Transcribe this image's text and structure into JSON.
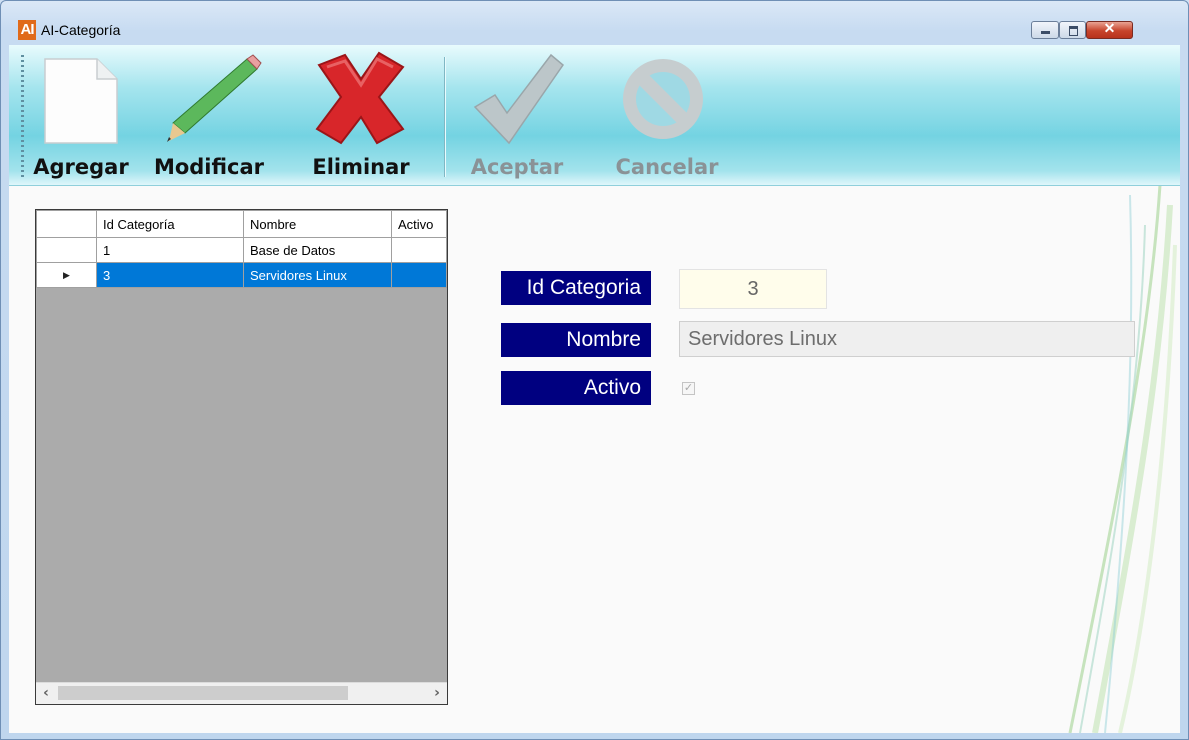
{
  "window": {
    "title": "AI-Categoría",
    "app_icon_text": "AI",
    "minimize_label": "minimize",
    "maximize_label": "maximize",
    "close_label": "close"
  },
  "toolbar": {
    "buttons": [
      {
        "label": "Agregar",
        "icon": "new-document-icon",
        "enabled": true
      },
      {
        "label": "Modificar",
        "icon": "pencil-icon",
        "enabled": true
      },
      {
        "label": "Eliminar",
        "icon": "red-x-icon",
        "enabled": true
      },
      {
        "label": "Aceptar",
        "icon": "checkmark-icon",
        "enabled": false
      },
      {
        "label": "Cancelar",
        "icon": "cancel-circle-icon",
        "enabled": false
      }
    ]
  },
  "grid": {
    "columns": [
      "Id Categoría",
      "Nombre",
      "Activo"
    ],
    "rows": [
      {
        "id": "1",
        "nombre": "Base de Datos",
        "activo": ""
      },
      {
        "id": "3",
        "nombre": "Servidores Linux",
        "activo": ""
      }
    ],
    "selected_row": 1,
    "current_row_glyph": "▶",
    "scroll_left": "‹",
    "scroll_right": "›"
  },
  "form": {
    "id_label": "Id Categoria",
    "id_value": "3",
    "nombre_label": "Nombre",
    "nombre_value": "Servidores Linux",
    "activo_label": "Activo",
    "activo_checked": true,
    "check_glyph": "✓"
  },
  "colors": {
    "label_bg": "#000080",
    "selection": "#0078d7",
    "toolbar": "#74d3e2"
  }
}
